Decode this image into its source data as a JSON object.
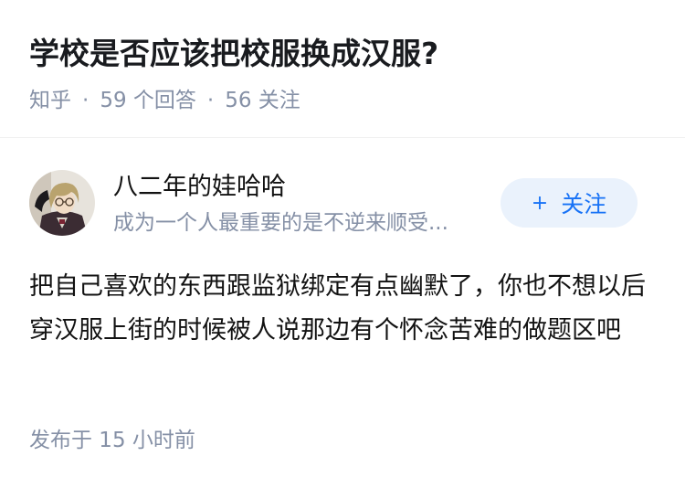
{
  "question": {
    "title": "学校是否应该把校服换成汉服?",
    "source": "知乎",
    "separator": "·",
    "answers": "59 个回答",
    "followers": "56 关注"
  },
  "author": {
    "name": "八二年的娃哈哈",
    "bio": "成为一个人最重要的是不逆来顺受...",
    "follow_label": "关注",
    "follow_icon": "+"
  },
  "answer": {
    "content": "把自己喜欢的东西跟监狱绑定有点幽默了，你也不想以后穿汉服上街的时候被人说那边有个怀念苦难的做题区吧",
    "time": "发布于 15 小时前"
  },
  "colors": {
    "title": "#191b1f",
    "meta": "#8590a6",
    "accent": "#1772f6",
    "follow_bg": "#eaf2fc"
  }
}
